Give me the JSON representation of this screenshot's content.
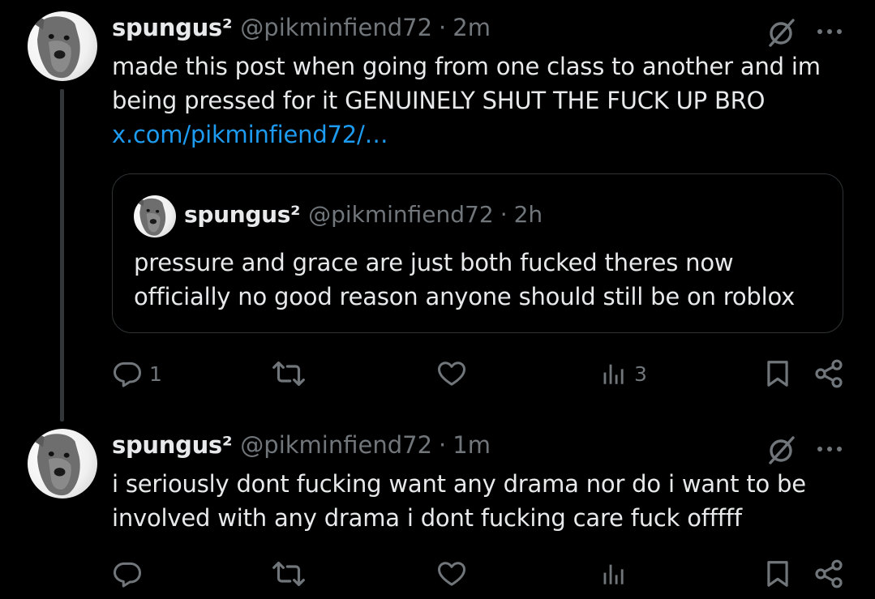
{
  "posts": [
    {
      "author": {
        "display_name": "spungus²",
        "handle": "@pikminfiend72",
        "avatar_icon": "dog-avatar"
      },
      "separator": "·",
      "time": "2m",
      "text": "made this post when going from one class to another and im being pressed for it GENUINELY SHUT THE FUCK UP BRO",
      "link": "x.com/pikminfiend72/…",
      "quote": {
        "author": {
          "display_name": "spungus²",
          "handle": "@pikminfiend72"
        },
        "separator": "·",
        "time": "2h",
        "text": "pressure and grace are just both fucked theres now officially no good reason anyone should still be on roblox"
      },
      "actions": {
        "reply_count": "1",
        "retweet_count": "",
        "like_count": "",
        "views_count": "3"
      }
    },
    {
      "author": {
        "display_name": "spungus²",
        "handle": "@pikminfiend72",
        "avatar_icon": "dog-avatar"
      },
      "separator": "·",
      "time": "1m",
      "text": "i seriously dont fucking want any drama nor do i want to be involved with any drama i dont fucking care fuck offfff",
      "actions": {
        "reply_count": "",
        "retweet_count": "",
        "like_count": "",
        "views_count": ""
      }
    }
  ],
  "colors": {
    "background": "#000000",
    "text": "#e7e9ea",
    "secondary": "#71767b",
    "link": "#1d9bf0",
    "border": "#2f3336",
    "thread_line": "#333639"
  }
}
